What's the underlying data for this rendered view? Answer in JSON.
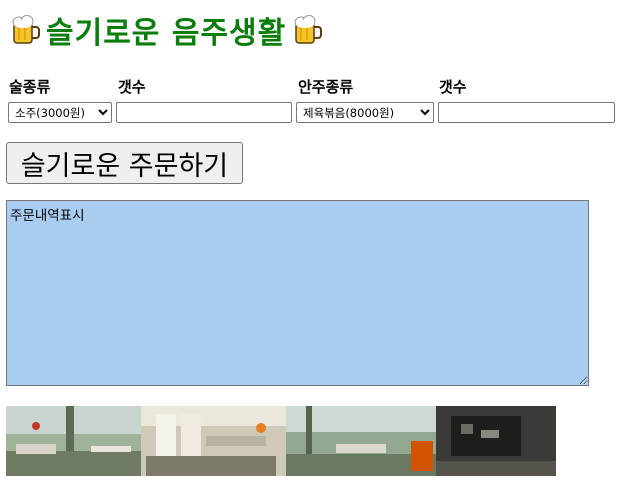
{
  "header": {
    "title": "슬기로운 음주생활",
    "left_icon": "beer-mug-icon",
    "right_icon": "beer-mug-icon",
    "title_color": "#0a7d0a"
  },
  "form": {
    "liquor_label": "술종류",
    "liquor_qty_label": "갯수",
    "snack_label": "안주종류",
    "snack_qty_label": "갯수",
    "liquor_selected": "소주(3000원)",
    "snack_selected": "제육볶음(8000원)",
    "liquor_qty_value": "",
    "snack_qty_value": ""
  },
  "order_button": {
    "label": "슬기로운 주문하기"
  },
  "order_display": {
    "text": "주문내역표시",
    "background": "#a9cdf0"
  },
  "banner": {
    "icon": "interior-photo-banner"
  }
}
